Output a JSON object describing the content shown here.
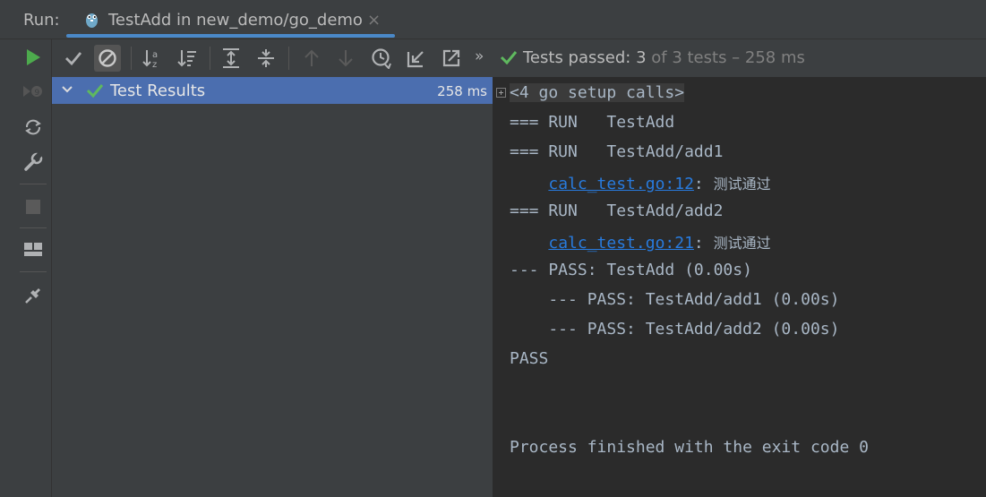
{
  "header": {
    "run_label": "Run:",
    "tab_title": "TestAdd in new_demo/go_demo",
    "close_glyph": "×"
  },
  "toolbar": {
    "status_prefix": "Tests passed:",
    "status_count": "3",
    "status_suffix": "of 3 tests – 258 ms",
    "more_glyph": "»"
  },
  "tree": {
    "root_label": "Test Results",
    "root_time": "258 ms"
  },
  "console": {
    "lines": [
      "<4 go setup calls>",
      "=== RUN   TestAdd",
      "=== RUN   TestAdd/add1",
      "    ",
      "=== RUN   TestAdd/add2",
      "    ",
      "--- PASS: TestAdd (0.00s)",
      "    --- PASS: TestAdd/add1 (0.00s)",
      "    --- PASS: TestAdd/add2 (0.00s)",
      "PASS",
      "Process finished with the exit code 0"
    ],
    "link1": "calc_test.go:12",
    "link2": "calc_test.go:21",
    "link_suffix": ": ",
    "message": "测试通过"
  },
  "colors": {
    "accent": "#4a88c7",
    "pass_green": "#5fb95f",
    "run_green": "#4dab4d",
    "selection": "#4b6eaf",
    "link": "#287bde"
  }
}
